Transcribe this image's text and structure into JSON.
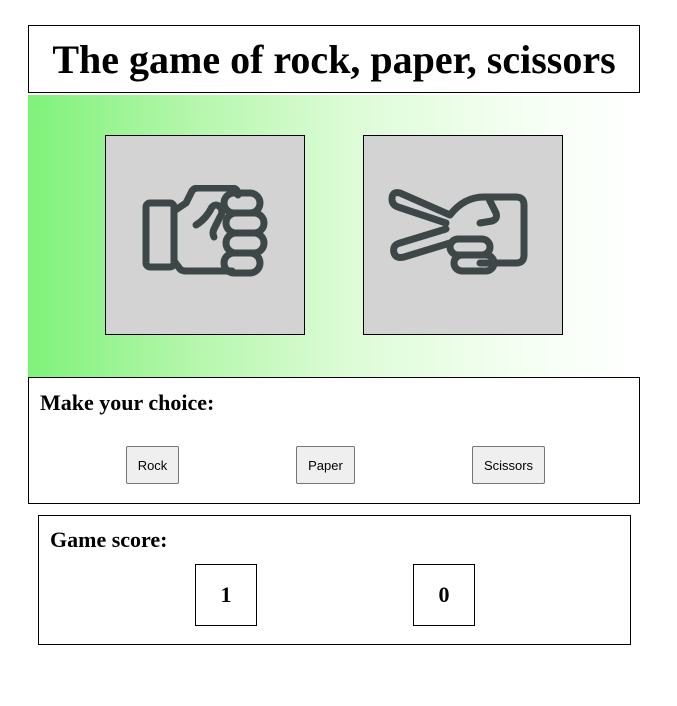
{
  "title": "The game of rock, paper, scissors",
  "arena": {
    "player_hand": "rock-fist-icon",
    "computer_hand": "scissors-hand-icon",
    "hand_color": "#3d4747",
    "card_background": "#d3d3d3",
    "gradient_colors": [
      "#7ff27a",
      "#ffffff"
    ]
  },
  "choice": {
    "heading": "Make your choice:",
    "buttons": {
      "rock": "Rock",
      "paper": "Paper",
      "scissors": "Scissors"
    }
  },
  "score": {
    "heading": "Game score:",
    "player": "1",
    "computer": "0"
  }
}
